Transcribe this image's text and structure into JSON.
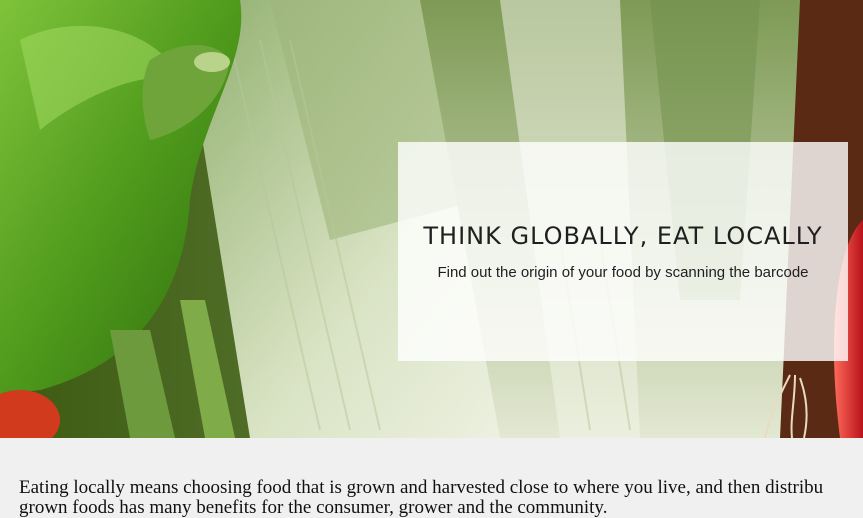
{
  "hero": {
    "image": "vegetables-hero",
    "title": "THINK GLOBALLY, EAT LOCALLY",
    "subtitle": "Find out the origin of your food by scanning the barcode"
  },
  "content": {
    "paragraph_line1": "Eating locally means choosing food that is grown and harvested close to where you live, and then distribu",
    "paragraph_line2": "grown foods has many benefits for the consumer, grower and the community."
  }
}
